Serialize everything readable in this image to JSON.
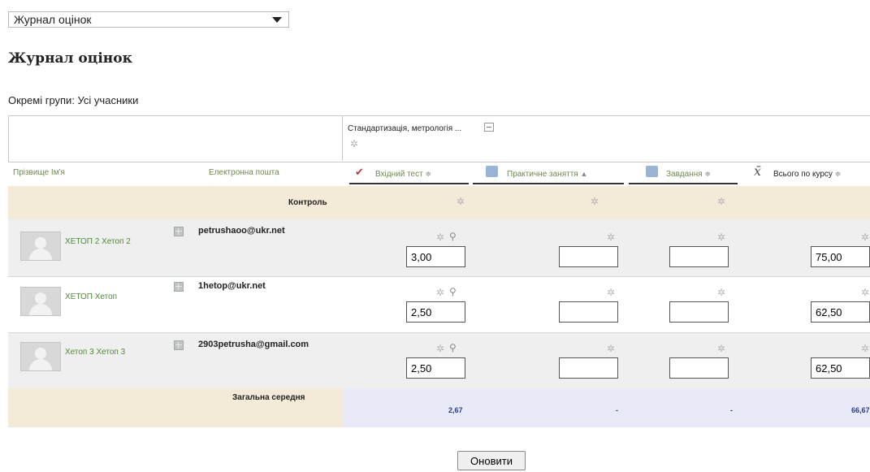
{
  "report_select": {
    "value": "Журнал оцінок"
  },
  "page_title": "Журнал оцінок",
  "groups": {
    "label": "Окремі групи: Усі учасники"
  },
  "category": {
    "title": "Стандартизація, метрологія ..."
  },
  "columns": {
    "name": "Прізвище Ім'я",
    "email": "Електронна пошта",
    "items": [
      {
        "label": "Вхідний тест",
        "icon": "quiz-icon",
        "sort": "≑"
      },
      {
        "label": "Практичне заняття",
        "icon": "assignment-icon",
        "sort": "▲"
      },
      {
        "label": "Завдання",
        "icon": "assignment-icon",
        "sort": "≑"
      },
      {
        "label": "Всього по курсу",
        "icon": "mean-icon",
        "sort": "≑"
      }
    ]
  },
  "control_row": {
    "label": "Контроль"
  },
  "students": [
    {
      "name": "ХЕТОП 2 Хетоп 2",
      "email": "petrushaoo@ukr.net",
      "grades": [
        "3,00",
        "",
        "",
        "75,00"
      ]
    },
    {
      "name": "ХЕТОП Хетоп",
      "email": "1hetop@ukr.net",
      "grades": [
        "2,50",
        "",
        "",
        "62,50"
      ]
    },
    {
      "name": "Хетоп 3 Хетоп 3",
      "email": "2903petrusha@gmail.com",
      "grades": [
        "2,50",
        "",
        "",
        "62,50"
      ]
    }
  ],
  "averages": {
    "label": "Загальна середня",
    "values": [
      "2,67",
      "-",
      "-",
      "66,67"
    ]
  },
  "buttons": {
    "refresh": "Оновити"
  },
  "colors": {
    "header_beige": "#f3ead8",
    "row_gray": "#efefef",
    "avg_blue": "#e8eaf7",
    "link_green": "#4f8a3a"
  }
}
